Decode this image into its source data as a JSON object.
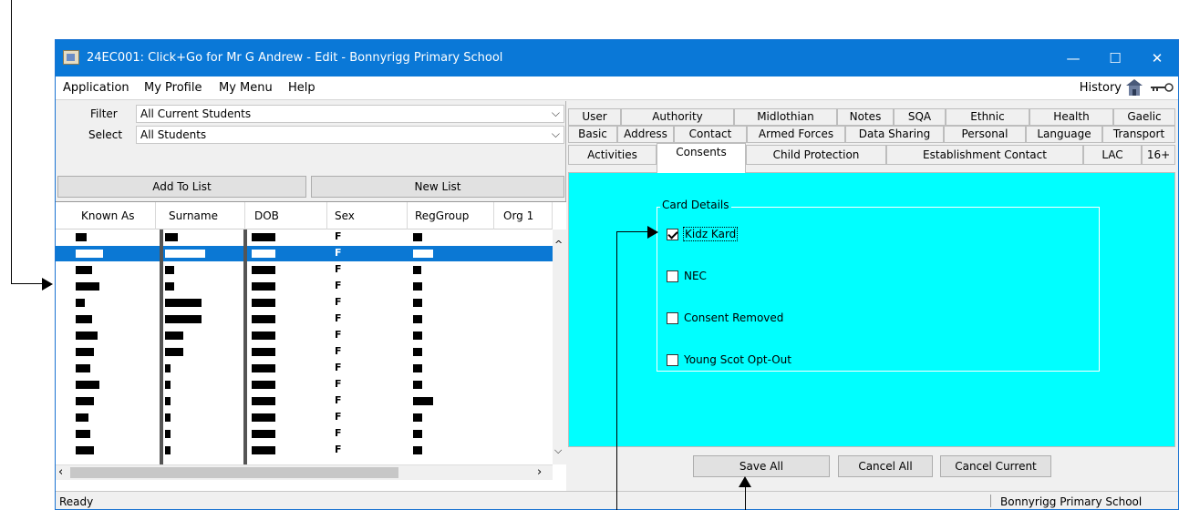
{
  "window": {
    "title": "24EC001: Click+Go for Mr G Andrew - Edit - Bonnyrigg Primary School",
    "minimize_glyph": "—",
    "maximize_glyph": "☐",
    "close_glyph": "✕"
  },
  "menubar": {
    "items": [
      "Application",
      "My Profile",
      "My Menu",
      "Help"
    ],
    "history_label": "History",
    "icons": [
      "home-icon",
      "key-icon"
    ]
  },
  "filters": {
    "filter_label": "Filter",
    "filter_value": "All Current Students",
    "select_label": "Select",
    "select_value": "All Students"
  },
  "list_buttons": {
    "add_to_list": "Add To List",
    "new_list": "New List"
  },
  "grid": {
    "columns": [
      "Known As",
      "Surname",
      "DOB",
      "Sex",
      "RegGroup",
      "Org 1"
    ],
    "sex_values": [
      "F",
      "F",
      "F",
      "F",
      "F",
      "F",
      "F",
      "F",
      "F",
      "F",
      "F",
      "F",
      "F",
      "F"
    ],
    "selected_row": 1,
    "row_count": 14
  },
  "tabs": {
    "row1": [
      "User",
      "Authority",
      "Midlothian",
      "Notes",
      "SQA",
      "Ethnic",
      "Health",
      "Gaelic"
    ],
    "row2": [
      "Basic",
      "Address",
      "Contact",
      "Armed Forces",
      "Data Sharing",
      "Personal",
      "Language",
      "Transport"
    ],
    "row3": [
      "Activities",
      "Consents",
      "Child Protection",
      "Establishment Contact",
      "LAC",
      "16+"
    ],
    "active": "Consents"
  },
  "card_details": {
    "legend": "Card Details",
    "options": [
      {
        "label": "Kidz Kard",
        "checked": true
      },
      {
        "label": "NEC",
        "checked": false
      },
      {
        "label": "Consent Removed",
        "checked": false
      },
      {
        "label": "Young Scot Opt-Out",
        "checked": false
      }
    ],
    "panel_color": "#00ffff"
  },
  "actions": {
    "save_all": "Save All",
    "cancel_all": "Cancel All",
    "cancel_current": "Cancel Current"
  },
  "status": {
    "left": "Ready",
    "right": "Bonnyrigg Primary School"
  },
  "colors": {
    "titlebar": "#0a78d7",
    "selection": "#0b78d4"
  }
}
